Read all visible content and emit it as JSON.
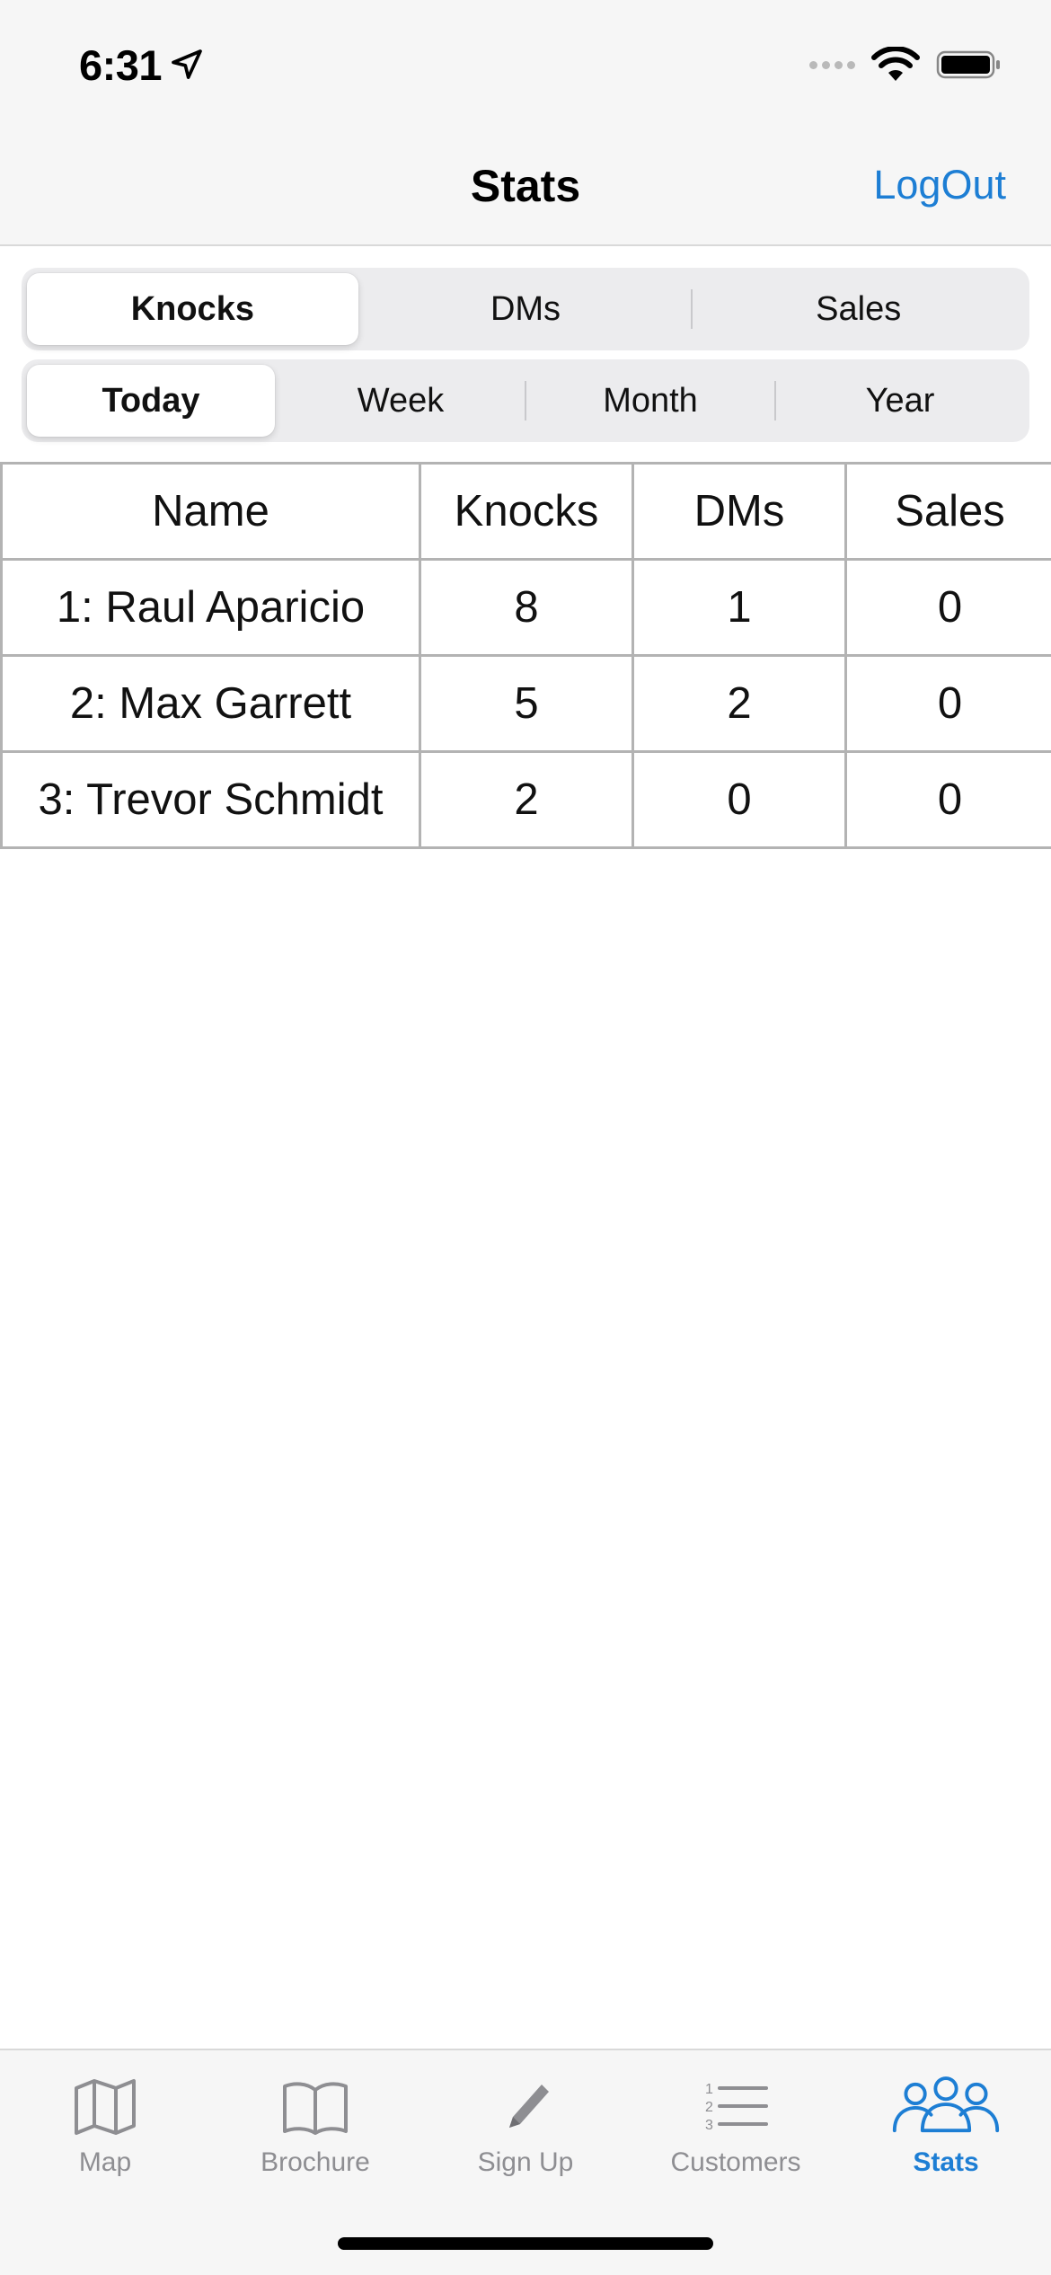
{
  "status_bar": {
    "time": "6:31"
  },
  "nav": {
    "title": "Stats",
    "logout_label": "LogOut"
  },
  "metric_segments": {
    "items": [
      "Knocks",
      "DMs",
      "Sales"
    ],
    "selected": "Knocks"
  },
  "period_segments": {
    "items": [
      "Today",
      "Week",
      "Month",
      "Year"
    ],
    "selected": "Today"
  },
  "table": {
    "headers": [
      "Name",
      "Knocks",
      "DMs",
      "Sales"
    ],
    "rows": [
      [
        "1: Raul Aparicio",
        "8",
        "1",
        "0"
      ],
      [
        "2: Max Garrett",
        "5",
        "2",
        "0"
      ],
      [
        "3: Trevor Schmidt",
        "2",
        "0",
        "0"
      ]
    ]
  },
  "tab_bar": {
    "items": [
      {
        "label": "Map",
        "icon": "map-icon"
      },
      {
        "label": "Brochure",
        "icon": "book-icon"
      },
      {
        "label": "Sign Up",
        "icon": "pencil-icon"
      },
      {
        "label": "Customers",
        "icon": "numbered-list-icon"
      },
      {
        "label": "Stats",
        "icon": "people-group-icon"
      }
    ],
    "selected": "Stats"
  },
  "colors": {
    "accent": "#1d7ed4",
    "inactive": "#8e8e92",
    "grid": "#b3b3b3"
  }
}
